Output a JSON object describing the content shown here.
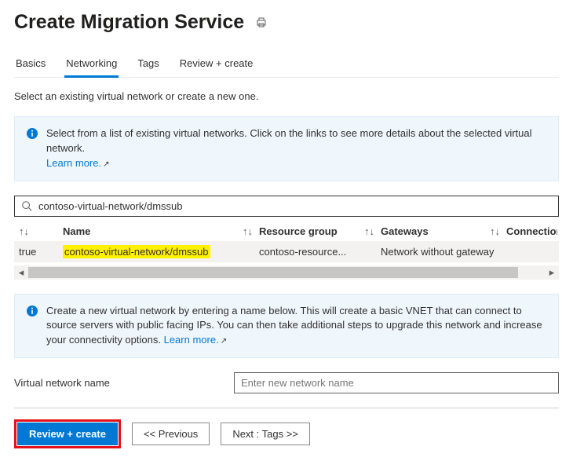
{
  "header": {
    "title": "Create Migration Service"
  },
  "tabs": [
    {
      "label": "Basics"
    },
    {
      "label": "Networking"
    },
    {
      "label": "Tags"
    },
    {
      "label": "Review + create"
    }
  ],
  "active_tab_index": 1,
  "intro": "Select an existing virtual network or create a new one.",
  "info_select": {
    "text": "Select from a list of existing virtual networks. Click on the links to see more details about the selected virtual network.",
    "learn_more": "Learn more."
  },
  "search": {
    "value": "contoso-virtual-network/dmssub"
  },
  "table": {
    "headers": {
      "name": "Name",
      "resource_group": "Resource group",
      "gateways": "Gateways",
      "connections": "Connection:"
    },
    "rows": [
      {
        "selected": "true",
        "name": "contoso-virtual-network/dmssub",
        "resource_group": "contoso-resource...",
        "gateways": "Network without gateway",
        "connections": ""
      }
    ]
  },
  "info_create": {
    "text": "Create a new virtual network by entering a name below. This will create a basic VNET that can connect to source servers with public facing IPs. You can then take additional steps to upgrade this network and increase your connectivity options.",
    "learn_more": "Learn more."
  },
  "vnet_name": {
    "label": "Virtual network name",
    "placeholder": "Enter new network name",
    "value": ""
  },
  "footer": {
    "review_create": "Review + create",
    "previous": "<<  Previous",
    "next": "Next : Tags >>"
  }
}
